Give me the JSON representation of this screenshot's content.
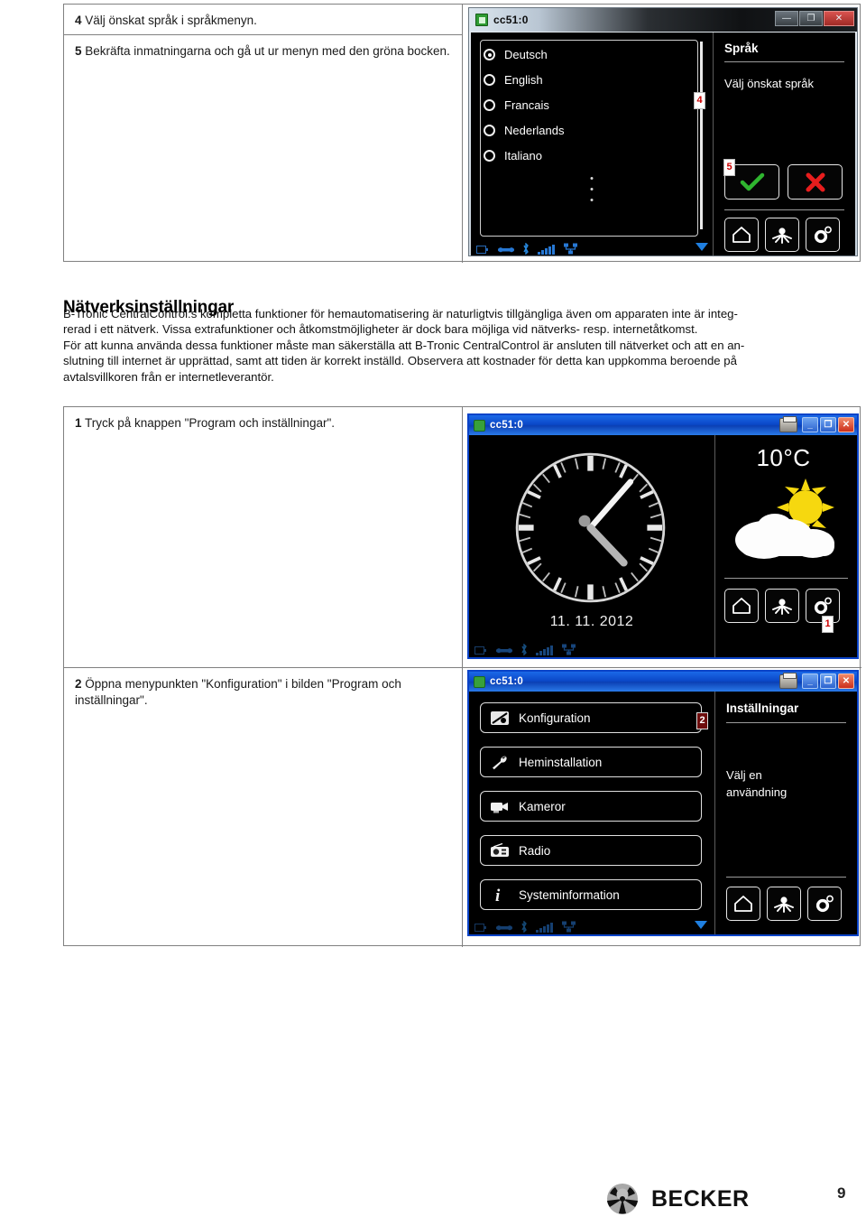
{
  "page": {
    "number": "9",
    "brand": "BECKER"
  },
  "top_steps": [
    {
      "num": "4",
      "text": "Välj önskat språk i språkmenyn."
    },
    {
      "num": "5",
      "text": "Bekräfta inmatningarna och gå ut ur menyn med den gröna bocken."
    }
  ],
  "section": {
    "title": "Nätverksinställningar",
    "lines": [
      "B-Tronic CentralControl:s kompletta funktioner för hemautomatisering är naturligtvis tillgängliga även om apparaten inte är integ-",
      "rerad i ett nätverk. Vissa extrafunktioner och åtkomstmöjligheter är dock bara möjliga vid nätverks- resp. internetåtkomst.",
      "För att kunna använda dessa funktioner måste man säkerställa att B-Tronic CentralControl är ansluten till nätverket och att en an-",
      "slutning till internet är upprättad, samt att tiden är korrekt inställd. Observera att kostnader för detta kan uppkomma beroende på",
      "avtalsvillkoren från er internetleverantör."
    ]
  },
  "bottom_steps": [
    {
      "num": "1",
      "text": "Tryck på knappen \"Program och inställningar\"."
    },
    {
      "num": "2",
      "text": "Öppna menypunkten \"Konfiguration\" i bilden \"Program och inställningar\"."
    }
  ],
  "screenshot_language": {
    "window_title": "cc51:0",
    "titlebar_buttons": {
      "minimize": "—",
      "maximize": "❐",
      "close": "✕"
    },
    "languages": [
      {
        "label": "Deutsch",
        "selected": true
      },
      {
        "label": "English",
        "selected": false
      },
      {
        "label": "Francais",
        "selected": false
      },
      {
        "label": "Nederlands",
        "selected": false
      },
      {
        "label": "Italiano",
        "selected": false
      }
    ],
    "panel_title": "Språk",
    "panel_text": "Välj önskat språk",
    "confirm_icon": "check-mark",
    "cancel_icon": "cross-mark",
    "nav_icons": [
      "home-icon",
      "scenes-icon",
      "settings-gear-icon"
    ],
    "badges": [
      {
        "num": "4"
      },
      {
        "num": "5"
      }
    ]
  },
  "screenshot_home": {
    "window_title": "cc51:0",
    "date": "11. 11. 2012",
    "temperature": "10°C",
    "weather_icon": "sun-behind-cloud-icon",
    "clock_icon": "analog-clock",
    "nav_icons": [
      "home-icon",
      "scenes-icon",
      "settings-gear-icon"
    ],
    "badges": [
      {
        "num": "1"
      }
    ]
  },
  "screenshot_config": {
    "window_title": "cc51:0",
    "menu_items": [
      {
        "label": "Konfiguration",
        "icon": "configuration-icon"
      },
      {
        "label": "Heminstallation",
        "icon": "wrench-icon"
      },
      {
        "label": "Kameror",
        "icon": "camera-icon"
      },
      {
        "label": "Radio",
        "icon": "radio-icon"
      },
      {
        "label": "Systeminformation",
        "icon": "info-icon"
      }
    ],
    "panel_title": "Inställningar",
    "panel_text_line1": "Välj en",
    "panel_text_line2": "användning",
    "nav_icons": [
      "home-icon",
      "scenes-icon",
      "settings-gear-icon"
    ],
    "badges": [
      {
        "num": "2"
      }
    ]
  },
  "colors": {
    "badge_red": "#cc0000",
    "confirm_green": "#2fb52f",
    "cancel_red": "#e81d1d",
    "titlebar_blue": "#0a46c6",
    "border_gray": "#808080"
  }
}
